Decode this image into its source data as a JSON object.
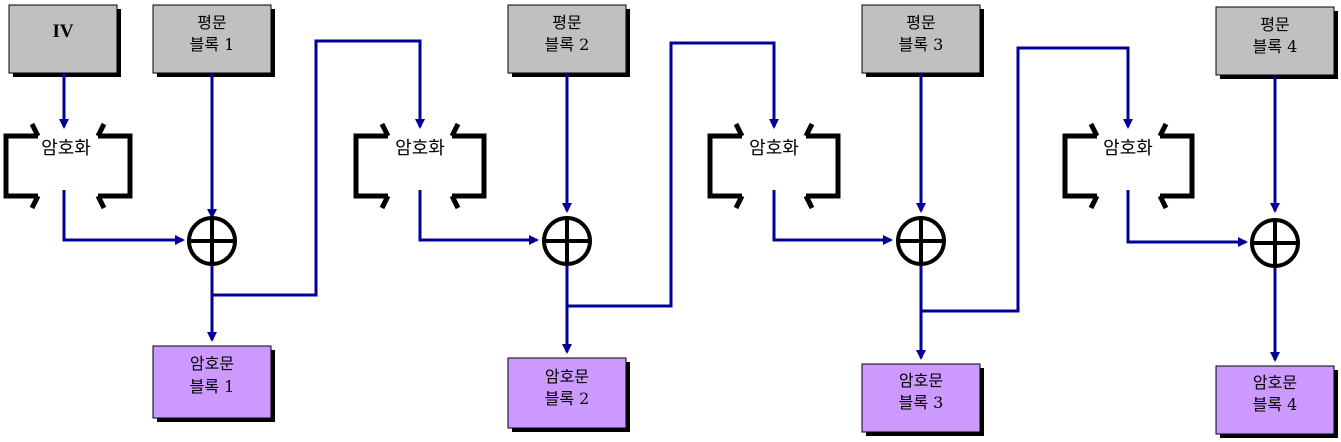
{
  "iv_label": "IV",
  "encrypt_label": "암호화",
  "plaintext_blocks": [
    {
      "line1": "평문",
      "line2": "블록 1"
    },
    {
      "line1": "평문",
      "line2": "블록 2"
    },
    {
      "line1": "평문",
      "line2": "블록 3"
    },
    {
      "line1": "평문",
      "line2": "블록 4"
    }
  ],
  "ciphertext_blocks": [
    {
      "line1": "암호문",
      "line2": "블록 1"
    },
    {
      "line1": "암호문",
      "line2": "블록 2"
    },
    {
      "line1": "암호문",
      "line2": "블록 3"
    },
    {
      "line1": "암호문",
      "line2": "블록 4"
    }
  ],
  "colors": {
    "plaintext_box": "#c0c0c0",
    "ciphertext_box": "#cc99ff",
    "wire": "#000099"
  }
}
